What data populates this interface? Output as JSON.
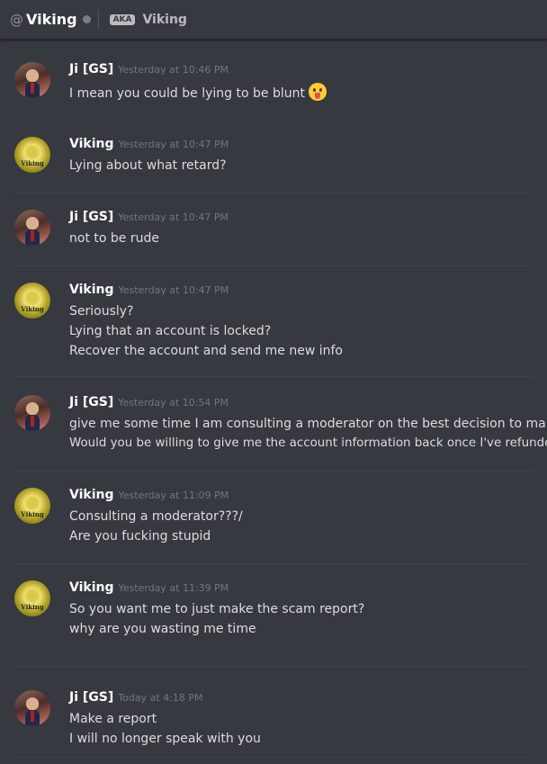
{
  "header": {
    "at_symbol": "@",
    "name": "Viking",
    "aka_badge": "AKA",
    "nickname": "Viking"
  },
  "messages": [
    {
      "author": "Ji [GS]",
      "timestamp": "Yesterday at 10:46 PM",
      "lines": [
        "I mean you could be lying to be blunt"
      ],
      "emoji": "tongue-face-emoji"
    },
    {
      "author": "Viking",
      "timestamp": "Yesterday at 10:47 PM",
      "lines": [
        "Lying about what retard?"
      ]
    },
    {
      "author": "Ji [GS]",
      "timestamp": "Yesterday at 10:47 PM",
      "lines": [
        "not to be rude"
      ]
    },
    {
      "author": "Viking",
      "timestamp": "Yesterday at 10:47 PM",
      "lines": [
        "Seriously?",
        "Lying that an account is locked?",
        "Recover the account and send me new info"
      ]
    },
    {
      "author": "Ji [GS]",
      "timestamp": "Yesterday at 10:54 PM",
      "lines": [
        "give me some time I am consulting a moderator on the best decision to make.",
        "Would you be willing to give me the account information back once I've refunded?"
      ]
    },
    {
      "author": "Viking",
      "timestamp": "Yesterday at 11:09 PM",
      "lines": [
        "Consulting a moderator???/",
        "Are you fucking stupid"
      ]
    },
    {
      "author": "Viking",
      "timestamp": "Yesterday at 11:39 PM",
      "lines": [
        "So you want me to just make the scam report?",
        "why are you wasting me time"
      ]
    },
    {
      "author": "Ji [GS]",
      "timestamp": "Today at 4:18 PM",
      "lines": [
        "Make a report",
        "I will no longer speak with you"
      ]
    }
  ],
  "avatar_labels": {
    "viking": "Viking"
  },
  "colors": {
    "background": "#36393f",
    "username": "#ffffff",
    "timestamp": "#72767d",
    "text": "#dcddde"
  }
}
